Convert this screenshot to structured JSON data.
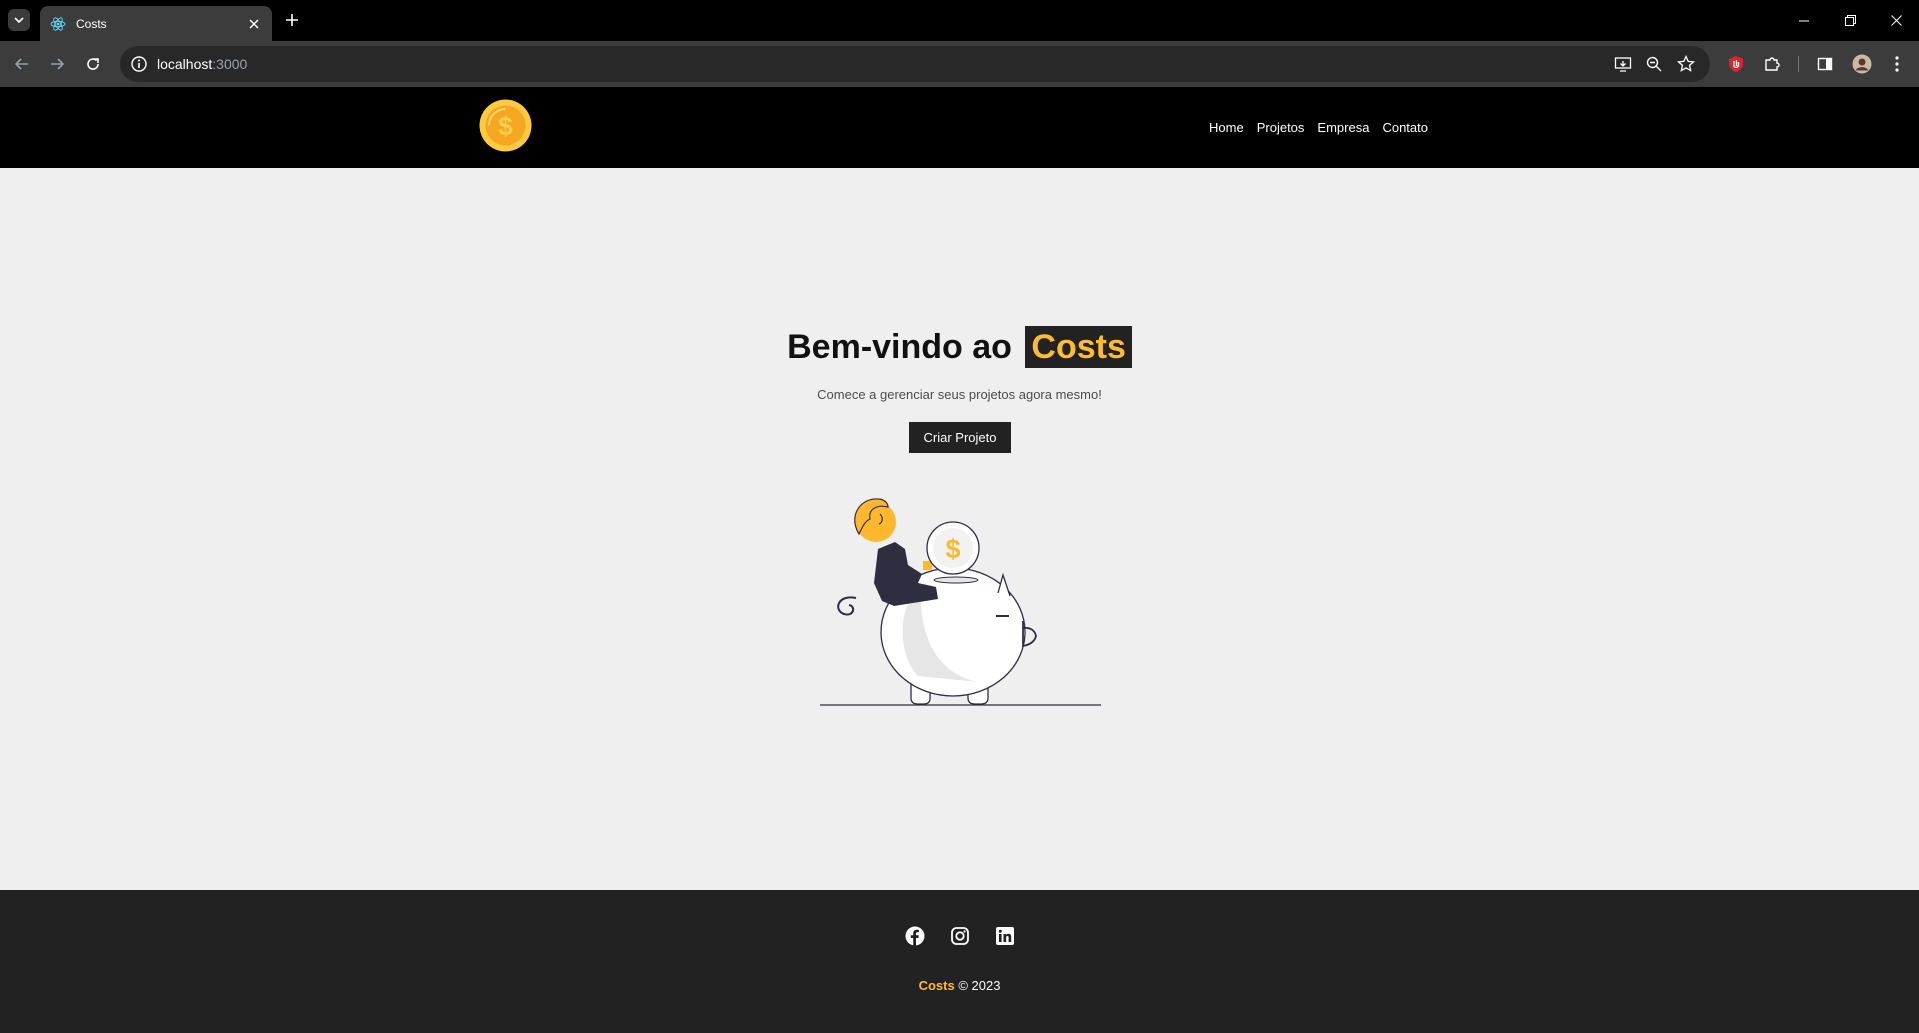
{
  "browser": {
    "tab_title": "Costs",
    "url_host": "localhost",
    "url_port": ":3000"
  },
  "header": {
    "logo_icon": "dollar-coin-icon",
    "nav": [
      "Home",
      "Projetos",
      "Empresa",
      "Contato"
    ]
  },
  "hero": {
    "title_prefix": "Bem-vindo ao",
    "title_brand": "Costs",
    "subtitle": "Comece a gerenciar seus projetos agora mesmo!",
    "cta_label": "Criar Projeto",
    "illustration": "piggy-bank-savings-illustration"
  },
  "footer": {
    "social": [
      "facebook-icon",
      "instagram-icon",
      "linkedin-icon"
    ],
    "brand": "Costs",
    "copyright": "© 2023"
  },
  "colors": {
    "accent": "#ffbb33",
    "dark": "#222222",
    "navbar": "#000000",
    "background": "#efefef"
  }
}
